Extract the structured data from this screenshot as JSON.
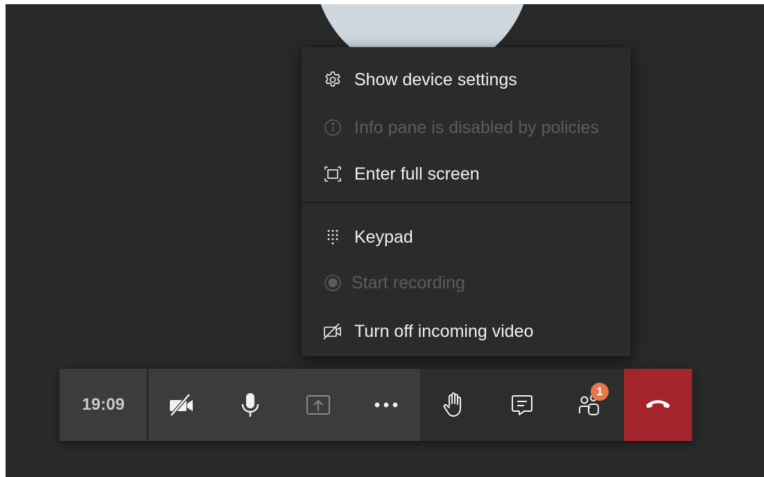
{
  "menu": {
    "items": [
      {
        "label": "Show device settings",
        "icon": "gear-icon",
        "enabled": true
      },
      {
        "label": "Info pane is disabled by policies",
        "icon": "info-icon",
        "enabled": false
      },
      {
        "label": "Enter full screen",
        "icon": "fullscreen-icon",
        "enabled": true
      },
      {
        "label": "Keypad",
        "icon": "keypad-icon",
        "enabled": true
      },
      {
        "label": "Start recording",
        "icon": "record-icon",
        "enabled": false
      },
      {
        "label": "Turn off incoming video",
        "icon": "video-off-icon",
        "enabled": true
      }
    ]
  },
  "toolbar": {
    "time": "19:09",
    "buttons": [
      {
        "name": "camera-off",
        "icon": "video-off-icon"
      },
      {
        "name": "microphone",
        "icon": "microphone-icon"
      },
      {
        "name": "share",
        "icon": "share-tray-icon"
      },
      {
        "name": "more-actions",
        "icon": "ellipsis-icon"
      },
      {
        "name": "raise-hand",
        "icon": "hand-icon"
      },
      {
        "name": "chat",
        "icon": "chat-icon"
      },
      {
        "name": "participants",
        "icon": "people-icon"
      },
      {
        "name": "hang-up",
        "icon": "hang-up-icon"
      }
    ],
    "participants_badge": "1"
  },
  "colors": {
    "stage_bg": "#292929",
    "menu_bg": "#2b2b2b",
    "toolbar_bg": "#3c3c3c",
    "hangup": "#a4262c",
    "badge": "#e97548",
    "avatar": "#cfd8df",
    "disabled_text": "#5c5c5c"
  }
}
